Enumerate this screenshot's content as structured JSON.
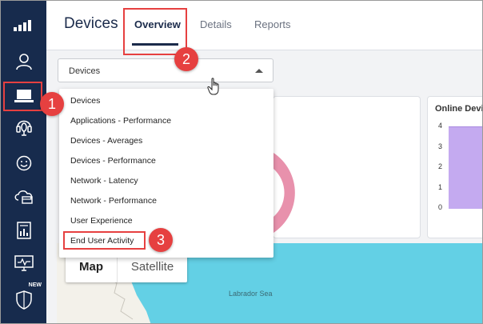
{
  "header": {
    "title": "Devices",
    "tabs": [
      {
        "label": "Overview"
      },
      {
        "label": "Details"
      },
      {
        "label": "Reports"
      }
    ]
  },
  "sidebar": {
    "items": [
      {
        "icon": "signal-bars-icon"
      },
      {
        "icon": "user-icon"
      },
      {
        "icon": "laptop-icon"
      },
      {
        "icon": "headset-icon"
      },
      {
        "icon": "smiley-icon"
      },
      {
        "icon": "cloud-icon"
      },
      {
        "icon": "report-icon"
      },
      {
        "icon": "monitor-pulse-icon"
      },
      {
        "icon": "shield-icon",
        "badge": "NEW"
      }
    ]
  },
  "select": {
    "value": "Devices"
  },
  "dropdown": {
    "options": [
      "Devices",
      "Applications - Performance",
      "Devices - Averages",
      "Devices - Performance",
      "Network - Latency",
      "Network - Performance",
      "User Experience",
      "End User Activity"
    ]
  },
  "cards": {
    "online_title": "Online Devi",
    "y_ticks": [
      "4",
      "3",
      "2",
      "1",
      "0"
    ]
  },
  "map": {
    "map_button": "Map",
    "satellite_button": "Satellite",
    "label": "Labrador Sea"
  },
  "callouts": [
    "1",
    "2",
    "3"
  ],
  "colors": {
    "sidebar": "#172b4d",
    "callout": "#e64040",
    "map_water": "#63d0e5",
    "chart_fill": "#c4aaf0"
  }
}
